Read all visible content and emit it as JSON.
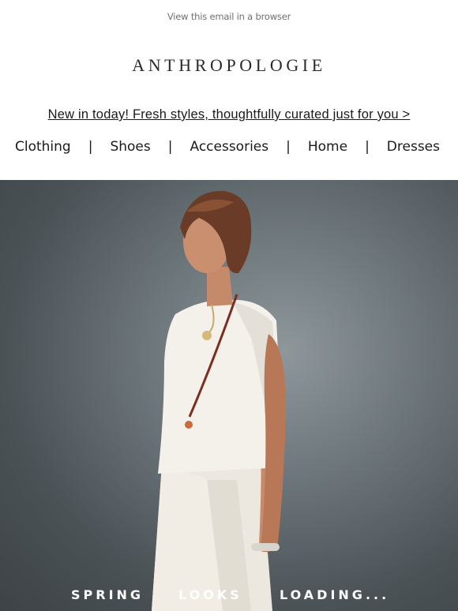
{
  "header": {
    "view_in_browser": "View this email in a browser",
    "brand": "ANTHROPOLOGIE",
    "promo": "New in today! Fresh styles, thoughtfully curated just for you >"
  },
  "nav": {
    "items": [
      "Clothing",
      "Shoes",
      "Accessories",
      "Home",
      "Dresses"
    ],
    "separator": "|"
  },
  "hero": {
    "caption_words": [
      "SPRING",
      "LOOKS",
      "LOADING..."
    ]
  },
  "colors": {
    "background": "#ffffff",
    "hero_backdrop": "#5d666a",
    "caption_text": "#ffffff"
  }
}
